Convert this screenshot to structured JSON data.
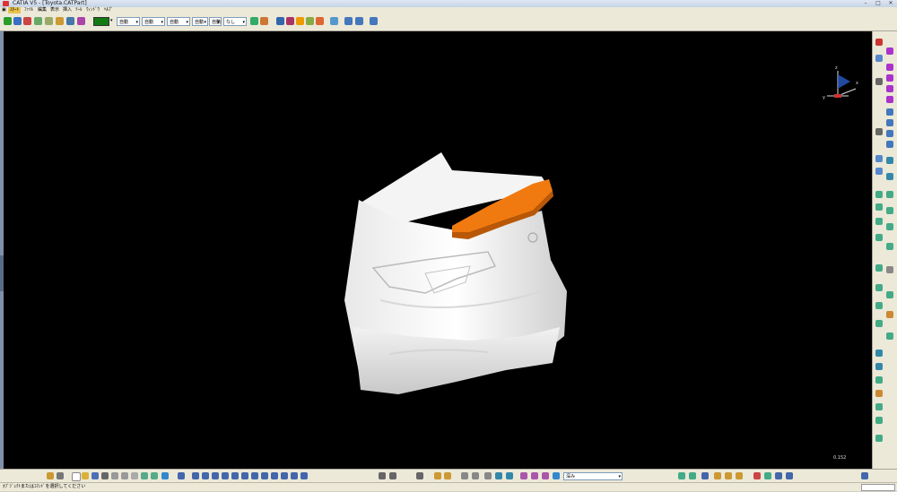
{
  "window": {
    "title": "CATIA V5 - [Toyota.CATPart]",
    "minimize": "–",
    "maximize": "□",
    "close": "✕"
  },
  "menu": {
    "items": [
      {
        "label": "ｽﾀｰﾄ",
        "active": true
      },
      {
        "label": "ﾌｧｲﾙ"
      },
      {
        "label": "編集"
      },
      {
        "label": "表示"
      },
      {
        "label": "挿入"
      },
      {
        "label": "ﾂｰﾙ"
      },
      {
        "label": "ｳｨﾝﾄﾞｳ"
      },
      {
        "label": "ﾍﾙﾌﾟ"
      }
    ]
  },
  "toolbar": {
    "dropdowns": [
      {
        "value": "自動"
      },
      {
        "value": "自動"
      },
      {
        "value": "自動"
      },
      {
        "value": "自動"
      },
      {
        "value": "自動"
      },
      {
        "value": "なし"
      }
    ],
    "layer_dropdown": "深み",
    "color_swatch": "#117a11"
  },
  "viewport": {
    "scale_label": "0.152",
    "axis_z": "z",
    "axis_x": "x",
    "axis_y": "y",
    "background": "#000000",
    "accent_color": "#f07a10"
  },
  "status": {
    "prompt": "ｵﾌﾞｼﾞｪｸﾄまたはｺﾏﾝﾄﾞを選択してください"
  }
}
